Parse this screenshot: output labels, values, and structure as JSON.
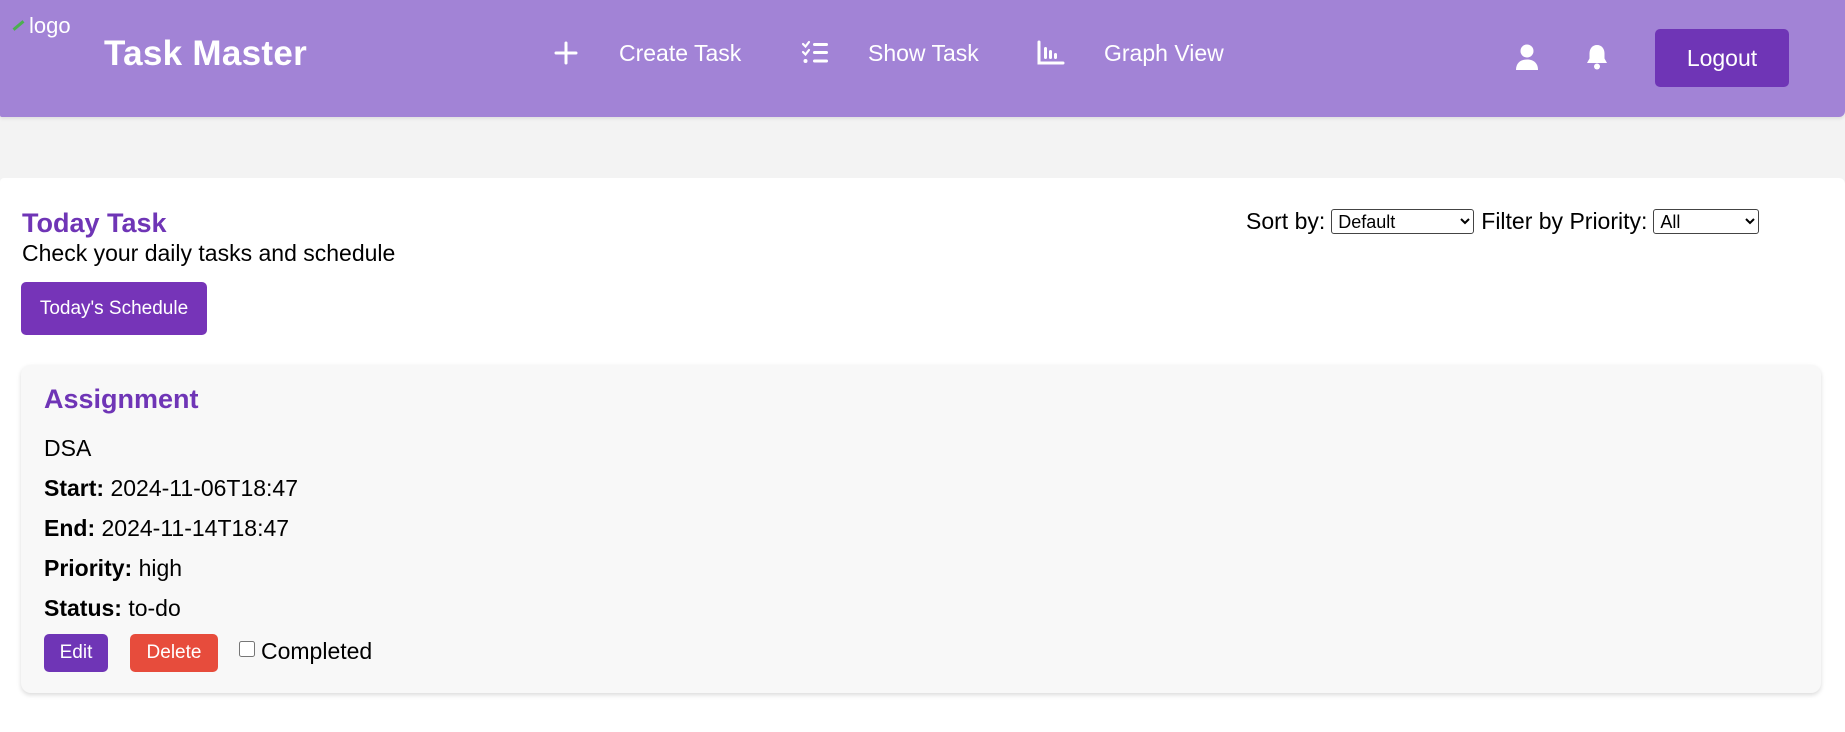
{
  "header": {
    "logo_alt": "logo",
    "brand": "Task Master",
    "nav": [
      {
        "label": "Create Task",
        "icon": "plus-icon"
      },
      {
        "label": "Show Task",
        "icon": "checklist-icon"
      },
      {
        "label": "Graph View",
        "icon": "bar-chart-icon"
      }
    ],
    "user_icon": "user-icon",
    "bell_icon": "bell-icon",
    "logout_label": "Logout",
    "colors": {
      "bar": "#a283d6",
      "button": "#6f35b6"
    }
  },
  "main": {
    "title": "Today Task",
    "subtitle": "Check your daily tasks and schedule",
    "schedule_button": "Today's Schedule",
    "sort_label": "Sort by:",
    "sort_selected": "Default",
    "filter_label": "Filter by Priority:",
    "filter_selected": "All"
  },
  "tasks": [
    {
      "title": "Assignment",
      "description": "DSA",
      "start_label": "Start:",
      "start": "2024-11-06T18:47",
      "end_label": "End:",
      "end": "2024-11-14T18:47",
      "priority_label": "Priority:",
      "priority": "high",
      "status_label": "Status:",
      "status": "to-do",
      "edit_label": "Edit",
      "delete_label": "Delete",
      "completed_label": "Completed",
      "completed": false
    }
  ],
  "colors": {
    "accent": "#6f35b6",
    "danger": "#e74c3c"
  }
}
